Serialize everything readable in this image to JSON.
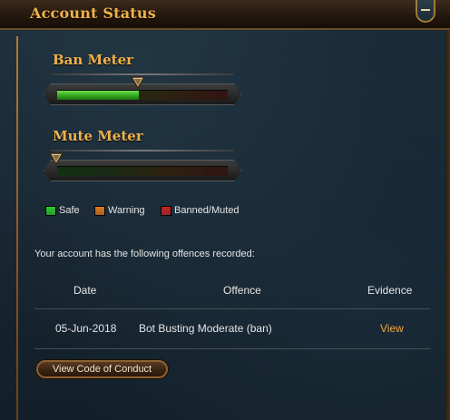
{
  "panel": {
    "title": "Account Status"
  },
  "ban_meter": {
    "title": "Ban Meter",
    "level": 0.48
  },
  "mute_meter": {
    "title": "Mute Meter",
    "level": 0.0
  },
  "legend": [
    {
      "label": "Safe",
      "color": "#2ecf2e"
    },
    {
      "label": "Warning",
      "color": "#e07a1a"
    },
    {
      "label": "Banned/Muted",
      "color": "#cf2222"
    }
  ],
  "offences": {
    "intro": "Your account has the following offences recorded:",
    "headers": {
      "date": "Date",
      "offence": "Offence",
      "evidence": "Evidence"
    },
    "rows": [
      {
        "date": "05-Jun-2018",
        "offence": "Bot Busting Moderate (ban)",
        "evidence": "View"
      }
    ]
  },
  "buttons": {
    "code_of_conduct": "View Code of Conduct"
  },
  "icons": {
    "collapse": "minus-icon",
    "meter_marker": "triangle-marker-icon"
  }
}
